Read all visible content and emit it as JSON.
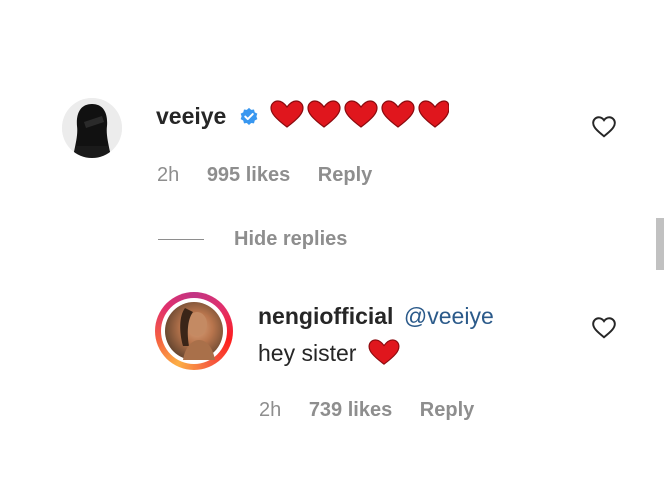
{
  "comment": {
    "username": "veeiye",
    "verified": true,
    "emoji": "❤️❤️❤️❤️❤️",
    "time": "2h",
    "likes": "995 likes",
    "reply_label": "Reply"
  },
  "hide_replies_label": "Hide replies",
  "reply": {
    "username": "nengiofficial",
    "mention": "@veeiye",
    "text": "hey sister",
    "emoji": "❤️",
    "time": "2h",
    "likes": "739 likes",
    "reply_label": "Reply"
  },
  "colors": {
    "heart_red": "#e0161d",
    "verified_blue": "#3897f0",
    "meta_gray": "#8e8e8e",
    "mention_blue": "#2b5a8a"
  },
  "icons": {
    "like": "heart-outline-icon",
    "verified": "verified-badge-icon"
  }
}
